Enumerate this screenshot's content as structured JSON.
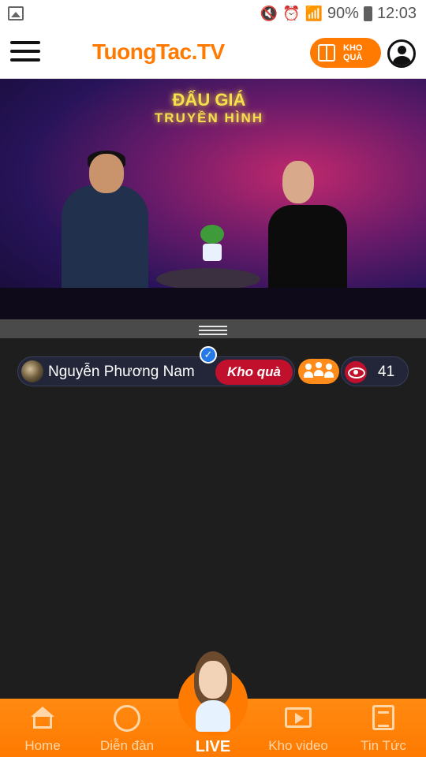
{
  "status_bar": {
    "battery_percent": "90%",
    "time": "12:03"
  },
  "header": {
    "logo": "TuongTac.TV",
    "kho_qua_label": "KHO QUÀ"
  },
  "video": {
    "sign_line1": "ĐẤU GIÁ",
    "sign_line2": "TRUYỀN HÌNH"
  },
  "host": {
    "name": "Nguyễn Phương Nam",
    "kho_qua_button": "Kho quà",
    "viewer_count": "41"
  },
  "bottom_nav": {
    "items": [
      {
        "label": "Home",
        "icon": "home-icon"
      },
      {
        "label": "Diễn đàn",
        "icon": "forum-icon"
      },
      {
        "label": "LIVE",
        "icon": "mascot"
      },
      {
        "label": "Kho video",
        "icon": "video-icon"
      },
      {
        "label": "Tin Tức",
        "icon": "news-icon"
      }
    ]
  },
  "colors": {
    "brand": "#ff7a00",
    "kho_qua_red": "#c0102b",
    "background": "#1e1e1e"
  }
}
